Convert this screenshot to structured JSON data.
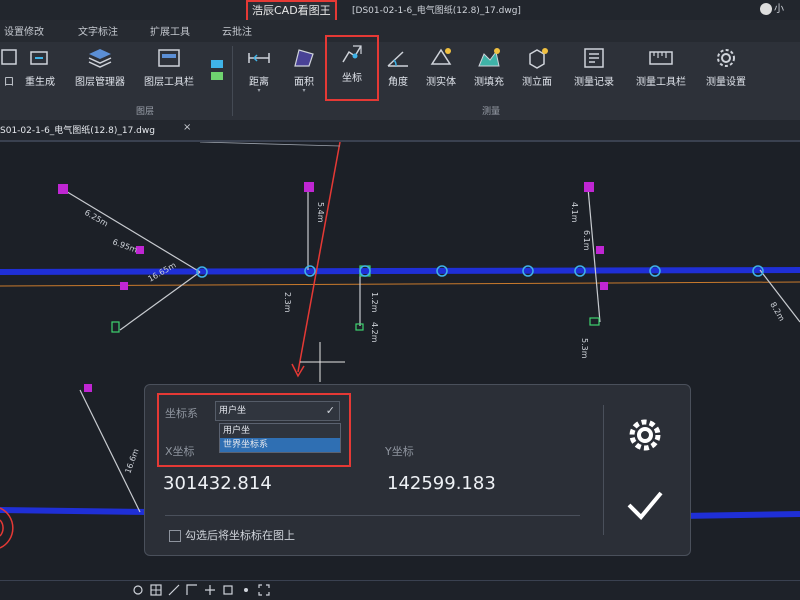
{
  "title_bar": {
    "app_title": "浩辰CAD看图王",
    "document_title": "[DS01-02-1-6_电气图纸(12.8)_17.dwg]",
    "user_label": "小"
  },
  "menu": {
    "tabs": [
      "设置修改",
      "文字标注",
      "扩展工具",
      "云批注"
    ]
  },
  "ribbon": {
    "buttons": [
      {
        "label": "口"
      },
      {
        "label": "重生成"
      },
      {
        "label": "图层管理器"
      },
      {
        "label": "图层工具栏"
      },
      {
        "label": "距离"
      },
      {
        "label": "面积"
      },
      {
        "label": "坐标"
      },
      {
        "label": "角度"
      },
      {
        "label": "测实体"
      },
      {
        "label": "测填充"
      },
      {
        "label": "测立面"
      },
      {
        "label": "测量记录"
      },
      {
        "label": "测量工具栏"
      },
      {
        "label": "测量设置"
      }
    ],
    "groups": [
      "图层",
      "测量"
    ]
  },
  "document_tab": {
    "label": "S01-02-1-6_电气图纸(12.8)_17.dwg",
    "close": "×"
  },
  "coordinate_dialog": {
    "coord_system_label": "坐标系",
    "coord_system_value": "用户坐",
    "options": [
      "用户坐",
      "世界坐标系"
    ],
    "x_label": "X坐标",
    "y_label": "Y坐标",
    "x_value": "301432.814",
    "y_value": "142599.183",
    "checkbox_label": "勾选后将坐标标在图上",
    "checked": false
  },
  "drawing_labels": [
    "6.25m",
    "6.95m",
    "16.65m",
    "2.3m",
    "5.4m",
    "4.2m",
    "1.2m",
    "5.3m",
    "4.1m",
    "6.1m",
    "8.2m",
    "16.6m"
  ],
  "colors": {
    "highlight": "#e53935",
    "accent": "#2f6fb3",
    "wire": "#1f2fd6",
    "device": "#c026d3"
  }
}
